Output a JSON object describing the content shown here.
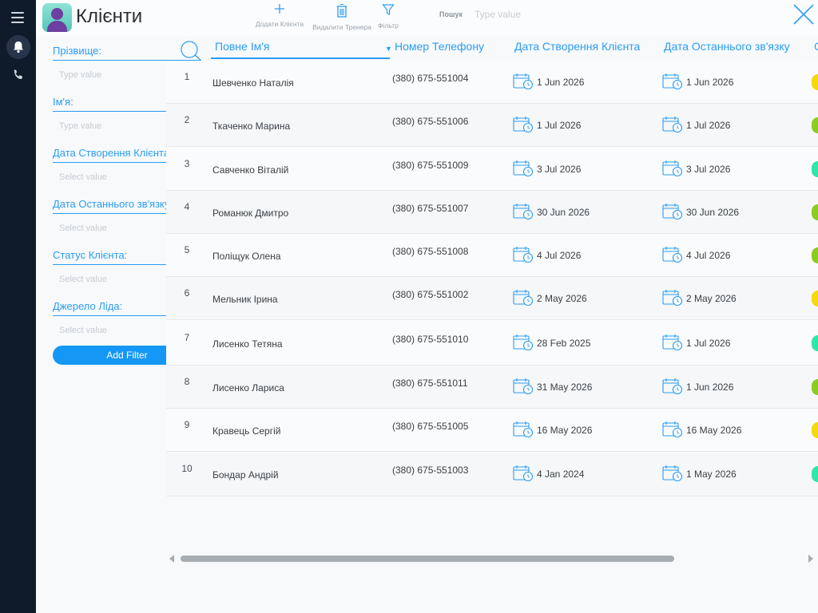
{
  "app": {
    "title": "Клієнти"
  },
  "toolbar": {
    "add_client": "Додати Клієнта",
    "delete_trainer": "Видалити Тренера",
    "filter": "Фільтр",
    "search_label": "Пошук",
    "search_placeholder": "Type value"
  },
  "filters": {
    "items": [
      {
        "label": "Прізвище:",
        "placeholder": "Type value"
      },
      {
        "label": "Ім'я:",
        "placeholder": "Type value"
      },
      {
        "label": "Дата Створення Клієнта:",
        "placeholder": "Select value"
      },
      {
        "label": "Дата Останнього зв'язку:",
        "placeholder": "Select value"
      },
      {
        "label": "Статус Клієнта:",
        "placeholder": "Select value"
      },
      {
        "label": "Джерело Ліда:",
        "placeholder": "Select value"
      }
    ],
    "add_button": "Add Filter"
  },
  "table": {
    "columns": {
      "name": "Повне Ім'я",
      "phone": "Номер Телефону",
      "created": "Дата Створення Клієнта",
      "last_contact": "Дата Останнього зв'язку",
      "status_partial": "С"
    },
    "rows": [
      {
        "idx": "1",
        "name": "Шевченко Наталія",
        "phone": "(380) 675-551004",
        "created": "1 Jun 2026",
        "last": "1 Jun 2026",
        "status_color": "#f5d90a"
      },
      {
        "idx": "2",
        "name": "Ткаченко Марина",
        "phone": "(380) 675-551006",
        "created": "1 Jul 2026",
        "last": "1 Jul 2026",
        "status_color": "#8ccc1f"
      },
      {
        "idx": "3",
        "name": "Савченко Віталій",
        "phone": "(380) 675-551009",
        "created": "3 Jul 2026",
        "last": "3 Jul 2026",
        "status_color": "#2ee6a8"
      },
      {
        "idx": "4",
        "name": "Романюк Дмитро",
        "phone": "(380) 675-551007",
        "created": "30 Jun 2026",
        "last": "30 Jun 2026",
        "status_color": "#8ccc1f"
      },
      {
        "idx": "5",
        "name": "Поліщук Олена",
        "phone": "(380) 675-551008",
        "created": "4 Jul 2026",
        "last": "4 Jul 2026",
        "status_color": "#8ccc1f"
      },
      {
        "idx": "6",
        "name": "Мельник Ірина",
        "phone": "(380) 675-551002",
        "created": "2 May 2026",
        "last": "2 May 2026",
        "status_color": "#f5d90a"
      },
      {
        "idx": "7",
        "name": "Лисенко Тетяна",
        "phone": "(380) 675-551010",
        "created": "28 Feb 2025",
        "last": "1 Jul 2026",
        "status_color": "#2ee6a8"
      },
      {
        "idx": "8",
        "name": "Лисенко Лариса",
        "phone": "(380) 675-551011",
        "created": "31 May 2026",
        "last": "1 Jun 2026",
        "status_color": "#8ccc1f"
      },
      {
        "idx": "9",
        "name": "Кравець Сергій",
        "phone": "(380) 675-551005",
        "created": "16 May 2026",
        "last": "16 May 2026",
        "status_color": "#f5d90a"
      },
      {
        "idx": "10",
        "name": "Бондар Андрій",
        "phone": "(380) 675-551003",
        "created": "4 Jan 2024",
        "last": "1 May 2026",
        "status_color": "#2ee6a8"
      }
    ]
  },
  "colors": {
    "accent": "#2a9df4",
    "rail": "#0f1a2b",
    "button": "#1497f5"
  }
}
